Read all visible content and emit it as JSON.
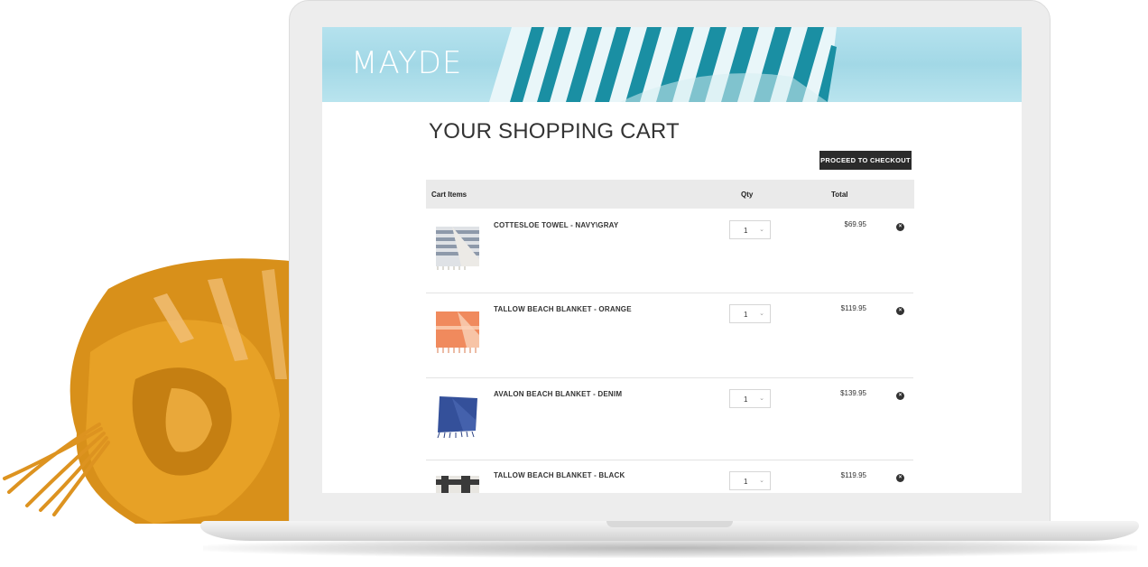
{
  "site": {
    "brand": "MAYDE"
  },
  "page": {
    "title": "YOUR SHOPPING CART"
  },
  "actions": {
    "checkout_label": "PROCEED TO CHECKOUT"
  },
  "cart": {
    "headers": {
      "items": "Cart Items",
      "qty": "Qty",
      "total": "Total"
    },
    "items": [
      {
        "name": "COTTESLOE TOWEL - NAVY\\GRAY",
        "qty": "1",
        "total": "$69.95",
        "thumb_color": "#8d99aa"
      },
      {
        "name": "TALLOW BEACH BLANKET - ORANGE",
        "qty": "1",
        "total": "$119.95",
        "thumb_color": "#f08a5d"
      },
      {
        "name": "AVALON BEACH BLANKET - DENIM",
        "qty": "1",
        "total": "$139.95",
        "thumb_color": "#34509a"
      },
      {
        "name": "TALLOW BEACH BLANKET - BLACK",
        "qty": "1",
        "total": "$119.95",
        "thumb_color": "#3a3a3a"
      }
    ]
  },
  "icons": {
    "remove": "close-circle-icon",
    "dropdown": "chevron-down-icon"
  },
  "colors": {
    "banner": "#a2d8e6",
    "stripe": "#1a8fa3",
    "button": "#2b2b2b",
    "blanket": "#e09a1e"
  }
}
